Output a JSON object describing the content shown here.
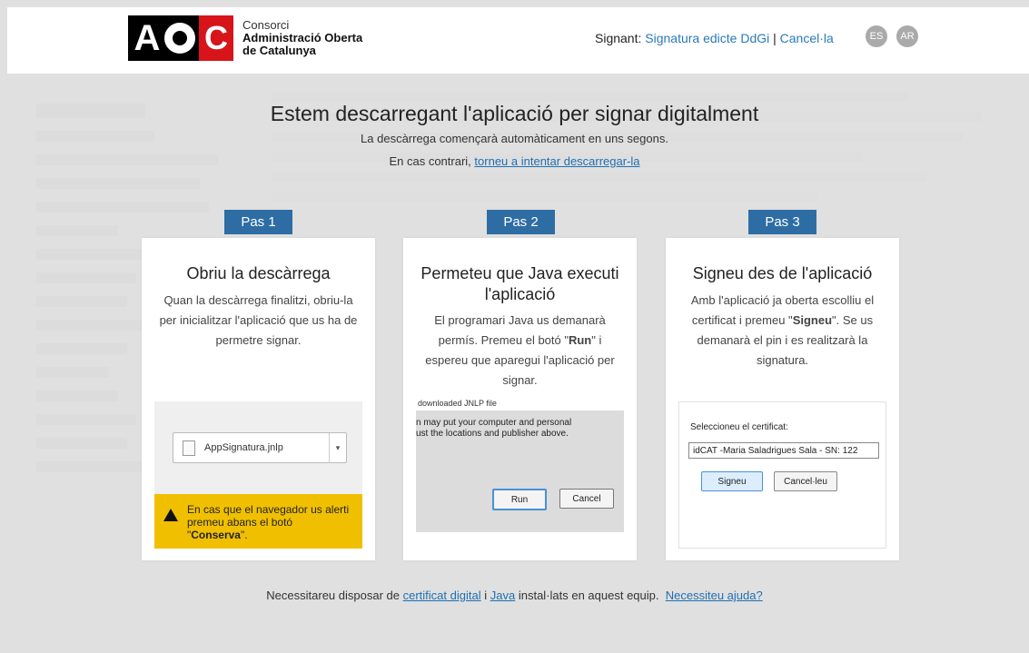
{
  "header": {
    "logo": {
      "letters": [
        "A",
        "C"
      ],
      "line1": "Consorci",
      "line2": "Administració Oberta",
      "line3": "de Catalunya"
    },
    "signant_label": "Signant:",
    "signant_doc": "Signatura edicte DdGi",
    "separator": "|",
    "cancel_link": "Cancel·la",
    "languages": [
      "ES",
      "AR"
    ]
  },
  "main": {
    "title": "Estem descarregant l'aplicació per signar digitalment",
    "subtitle": "La descàrrega començarà automàticament en uns segons.",
    "retry_prefix": "En cas contrari,",
    "retry_link": "torneu a intentar descarregar-la"
  },
  "steps": [
    {
      "tab": "Pas 1",
      "title": "Obriu la descàrrega",
      "text": "Quan la descàrrega finalitzi, obriu-la per inicialitzar l'aplicació que us ha de permetre signar.",
      "shot": {
        "file_name": "AppSignatura.jnlp",
        "warning_text": "En cas que el navegador us alerti premeu abans el botó",
        "warning_button": "Conserva",
        "warning_end": "."
      }
    },
    {
      "tab": "Pas 2",
      "title": "Permeteu que Java executi l'aplicació",
      "text_before": "El programari Java us demanarà permís. Premeu el botó \"",
      "text_bold": "Run",
      "text_after": "\" i espereu que aparegui l'aplicació per signar.",
      "shot": {
        "top_text": "downloaded JNLP file",
        "line1": "n may put your computer and personal",
        "line2": "ust the locations and publisher above.",
        "run_button": "Run",
        "cancel_button": "Cancel"
      }
    },
    {
      "tab": "Pas 3",
      "title": "Signeu des de l'aplicació",
      "text_before": "Amb l'aplicació ja oberta escolliu el certificat i premeu \"",
      "text_bold": "Signeu",
      "text_after": "\". Se us demanarà el pin i es realitzarà la signatura.",
      "shot": {
        "label": "Seleccioneu el certificat:",
        "certificate": "idCAT -Maria Saladrigues Sala - SN: 122",
        "sign_button": "Signeu",
        "cancel_button": "Cancel·leu"
      }
    }
  ],
  "footer": {
    "prefix": "Necessitareu disposar de",
    "cert_link": "certificat digital",
    "and": "i",
    "java_link": "Java",
    "suffix": "instal·lats en aquest equip.",
    "help_link": "Necessiteu ajuda?"
  },
  "colors": {
    "tab": "#2e6da4",
    "link": "#1f6fb2",
    "warning": "#f0c000",
    "logo_red": "#d7141a"
  }
}
